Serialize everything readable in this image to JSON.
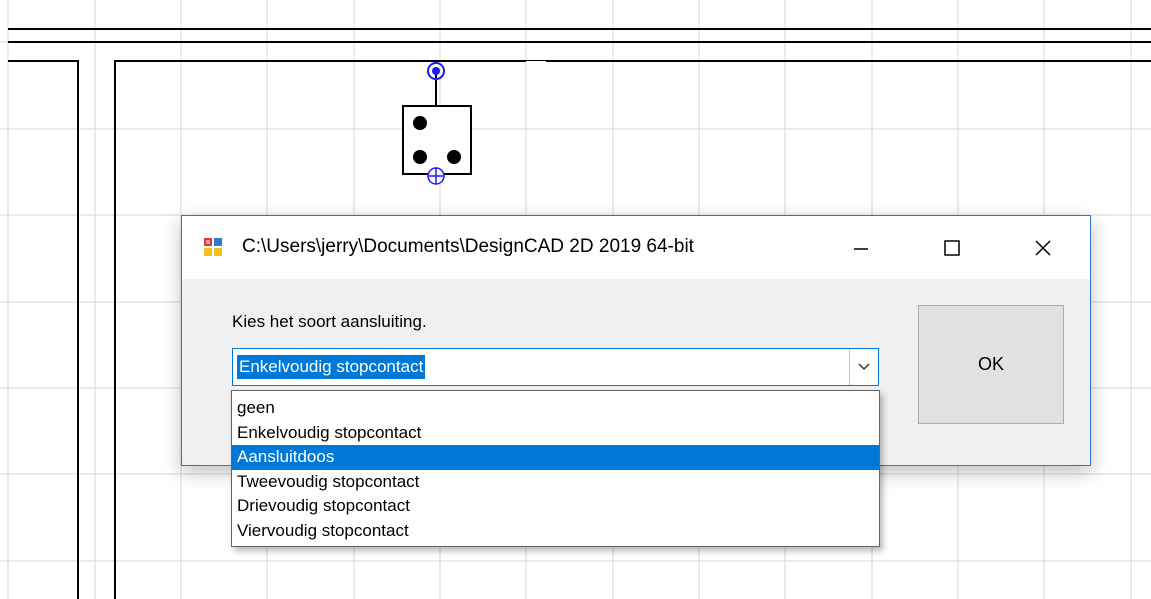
{
  "dialog": {
    "title": "C:\\Users\\jerry\\Documents\\DesignCAD 2D 2019 64-bit",
    "prompt": "Kies het soort aansluiting.",
    "combo_value": "Enkelvoudig stopcontact",
    "ok_label": "OK",
    "icons": {
      "app": "designcad-app-icon",
      "minimize": "minimize-icon",
      "maximize": "maximize-icon",
      "close": "close-icon",
      "dropdown": "chevron-down-icon"
    }
  },
  "dropdown": {
    "items": [
      {
        "label": "geen",
        "selected": false
      },
      {
        "label": "Enkelvoudig stopcontact",
        "selected": false
      },
      {
        "label": "Aansluitdoos",
        "selected": true
      },
      {
        "label": "Tweevoudig stopcontact",
        "selected": false
      },
      {
        "label": "Drievoudig stopcontact",
        "selected": false
      },
      {
        "label": "Viervoudig stopcontact",
        "selected": false
      }
    ]
  },
  "colors": {
    "accent": "#0078d7",
    "dialog_border": "#2b79d6",
    "snap_marker": "#1a1aff",
    "grid": "#d7d7d7"
  }
}
